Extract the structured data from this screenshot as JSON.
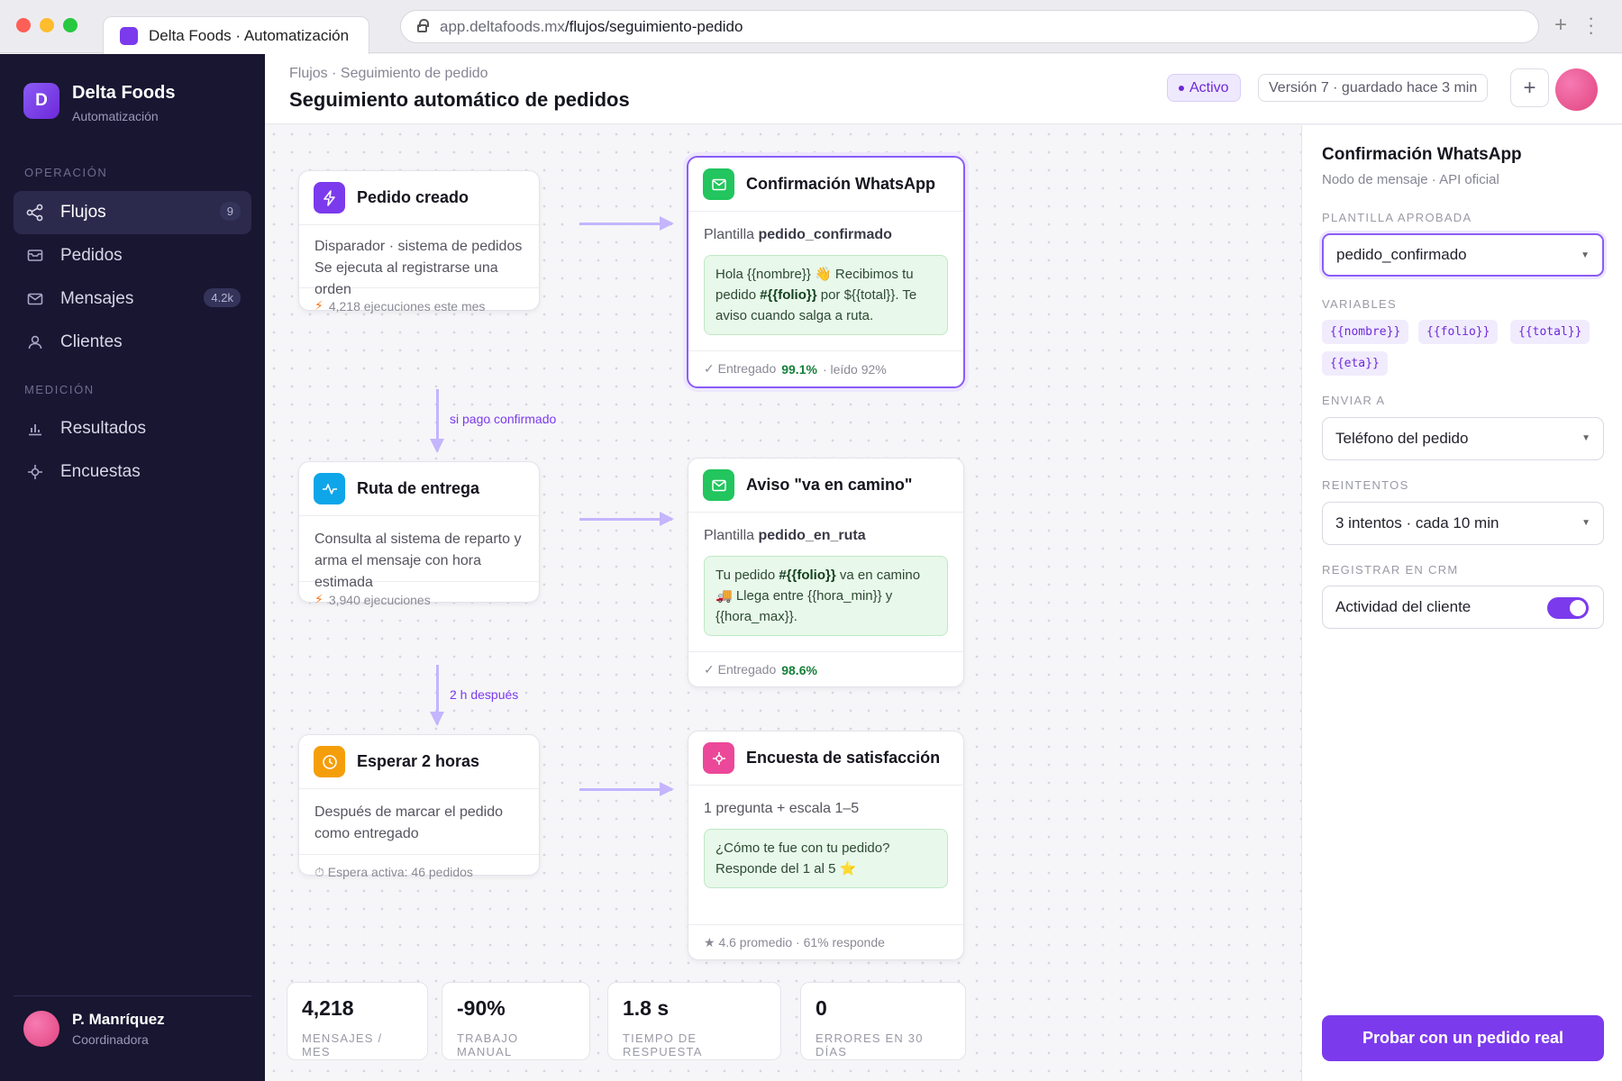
{
  "browser": {
    "tab_title": "Delta Foods · Automatización",
    "url_host": "app.deltafoods.mx",
    "url_path": "/flujos/seguimiento-pedido"
  },
  "sidebar": {
    "logo_letter": "D",
    "brand_name": "Delta Foods",
    "brand_sub": "Automatización",
    "section_operacion": "OPERACIÓN",
    "section_medicion": "MEDICIÓN",
    "items": [
      {
        "label": "Flujos",
        "badge": "9",
        "icon": "share-icon"
      },
      {
        "label": "Pedidos",
        "badge": "",
        "icon": "inbox-icon"
      },
      {
        "label": "Mensajes",
        "badge": "4.2k",
        "icon": "mail-icon"
      },
      {
        "label": "Clientes",
        "badge": "",
        "icon": "user-icon"
      },
      {
        "label": "Resultados",
        "badge": "",
        "icon": "bar-chart-icon"
      },
      {
        "label": "Encuestas",
        "badge": "",
        "icon": "target-icon"
      }
    ],
    "user": {
      "name": "P. Manríquez",
      "role": "Coordinadora"
    }
  },
  "header": {
    "breadcrumb": "Flujos · Seguimiento de pedido",
    "title": "Seguimiento automático de pedidos",
    "status": "Activo",
    "version": "Versión 7 · guardado hace 3 min",
    "plus": "+"
  },
  "nodes": {
    "pedido_creado": {
      "title": "Pedido creado",
      "line1": "Disparador · sistema de pedidos",
      "line2": "Se ejecuta al registrarse una orden",
      "footer": "4,218 ejecuciones este mes"
    },
    "ruta": {
      "title": "Ruta de entrega",
      "body": "Consulta al sistema de reparto y arma el mensaje con hora estimada",
      "footer": "3,940 ejecuciones"
    },
    "esperar": {
      "title": "Esperar 2 horas",
      "body": "Después de marcar el pedido como entregado",
      "footer": "⏱ Espera activa: 46 pedidos"
    },
    "whatsapp": {
      "title": "Confirmación WhatsApp",
      "tpl_prefix": "Plantilla",
      "tpl_name": "pedido_confirmado",
      "msg_a": "Hola {{nombre}} 👋 Recibimos tu pedido ",
      "msg_b": "#{{folio}}",
      "msg_c": " por ${{total}}. Te aviso cuando salga a ruta.",
      "foot_a": "✓ Entregado",
      "foot_b": "99.1%",
      "foot_c": "· leído 92%"
    },
    "en_camino": {
      "title": "Aviso \"va en camino\"",
      "tpl_prefix": "Plantilla",
      "tpl_name": "pedido_en_ruta",
      "msg_a": "Tu pedido ",
      "msg_b": "#{{folio}}",
      "msg_c": " va en camino 🚚 Llega entre {{hora_min}} y {{hora_max}}.",
      "foot_a": "✓ Entregado",
      "foot_b": "98.6%"
    },
    "encuesta": {
      "title": "Encuesta de satisfacción",
      "tpl_line": "1 pregunta + escala 1–5",
      "msg": "¿Cómo te fue con tu pedido? Responde del 1 al 5 ⭐",
      "footer": "★ 4.6 promedio · 61% responde"
    }
  },
  "edges": {
    "label1": "si pago confirmado",
    "label2": "2 h después"
  },
  "stats": [
    {
      "value": "4,218",
      "label": "MENSAJES / MES"
    },
    {
      "value": "-90%",
      "label": "TRABAJO MANUAL"
    },
    {
      "value": "1.8 s",
      "label": "TIEMPO DE RESPUESTA"
    },
    {
      "value": "0",
      "label": "ERRORES EN 30 DÍAS"
    }
  ],
  "panel": {
    "title": "Confirmación WhatsApp",
    "subtitle": "Nodo de mensaje · API oficial",
    "template_label": "PLANTILLA APROBADA",
    "template_value": "pedido_confirmado",
    "variables_label": "VARIABLES",
    "variables": [
      "{{nombre}}",
      "{{folio}}",
      "{{total}}",
      "{{eta}}"
    ],
    "send_to_label": "ENVIAR A",
    "send_to_value": "Teléfono del pedido",
    "retries_label": "REINTENTOS",
    "retries_value": "3 intentos · cada 10 min",
    "crm_label": "REGISTRAR EN CRM",
    "crm_value": "Actividad del cliente",
    "crm_enabled": true,
    "cta": "Probar con un pedido real"
  },
  "colors": {
    "accent": "#7c3aed",
    "sidebar_bg": "#181631",
    "success": "#16803a",
    "bubble_bg": "#e8f8ea"
  }
}
